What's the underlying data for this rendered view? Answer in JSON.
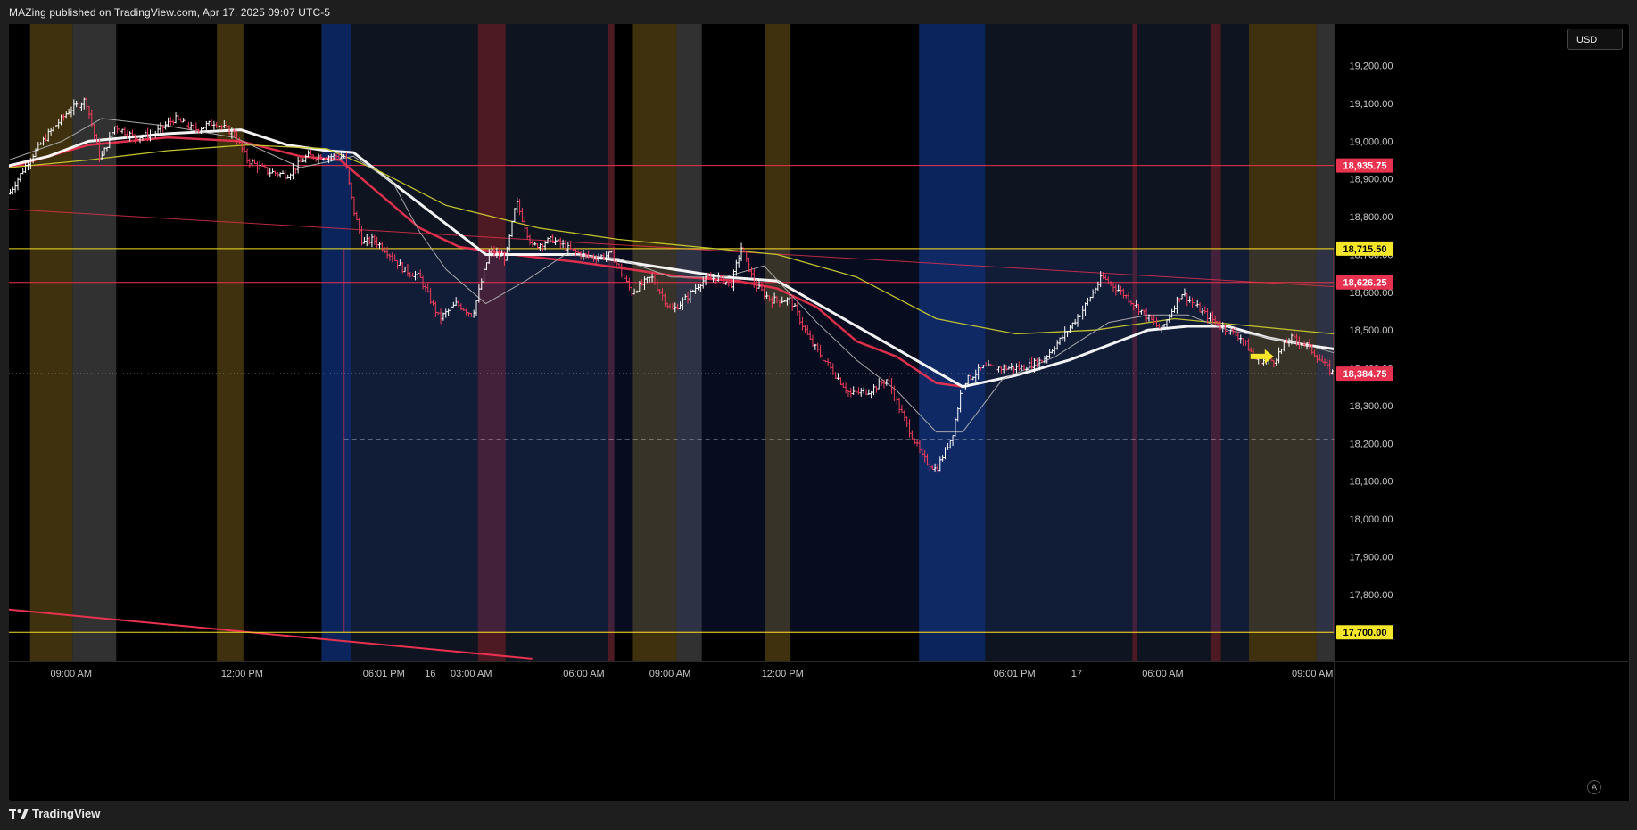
{
  "header": {
    "publish_text": "MAZing published on TradingView.com, Apr 17, 2025 09:07 UTC-5"
  },
  "brand": {
    "name": "TradingView"
  },
  "price_axis": {
    "currency": "USD",
    "autoscale_label": "A"
  },
  "colors": {
    "background": "#000000",
    "up": "#ffffff",
    "down": "#f23d5c",
    "ema_fast": "#ffffff",
    "ema_mid": "#e8324f",
    "ema_slow": "#c8c832",
    "sma_thin": "#b0b0b0",
    "level_red": "#e8324f",
    "level_yellow": "#f0e020",
    "label_red_bg": "#e8324f",
    "label_yellow_bg": "#f5e62a",
    "axis_text": "#c8c8c8",
    "session_asia": "#0d2a6b",
    "session_london": "#4a3a10",
    "session_ny_pre": "#3a3a3a",
    "session_night": "#101826",
    "session_kill": "#5a1f2a"
  },
  "chart_data": {
    "type": "candlestick",
    "symbol": "",
    "ylim": [
      17625,
      19310
    ],
    "y_ticks": [
      17700,
      17800,
      17900,
      18000,
      18100,
      18200,
      18300,
      18400,
      18500,
      18600,
      18700,
      18800,
      18900,
      19000,
      19100,
      19200
    ],
    "y_tick_labels": [
      "17,700.00",
      "17,800.00",
      "17,900.00",
      "18,000.00",
      "18,100.00",
      "18,200.00",
      "18,300.00",
      "18,400.00",
      "18,500.00",
      "18,600.00",
      "18,700.00",
      "18,800.00",
      "18,900.00",
      "19,000.00",
      "19,100.00",
      "19,200.00"
    ],
    "xlim": [
      0,
      100
    ],
    "x_ticks": [
      {
        "x": 4.7,
        "label": "09:00 AM"
      },
      {
        "x": 17.6,
        "label": "12:00 PM"
      },
      {
        "x": 28.3,
        "label": "06:01 PM"
      },
      {
        "x": 31.8,
        "label": "16"
      },
      {
        "x": 34.9,
        "label": "03:00 AM"
      },
      {
        "x": 43.4,
        "label": "06:00 AM"
      },
      {
        "x": 49.9,
        "label": "09:00 AM"
      },
      {
        "x": 58.4,
        "label": "12:00 PM"
      },
      {
        "x": 75.9,
        "label": "06:01 PM"
      },
      {
        "x": 80.6,
        "label": "17"
      },
      {
        "x": 87.1,
        "label": "06:00 AM"
      },
      {
        "x": 98.4,
        "label": "09:00 AM"
      }
    ],
    "price_path": [
      [
        0,
        18860
      ],
      [
        1.5,
        18950
      ],
      [
        3,
        19020
      ],
      [
        4.5,
        19080
      ],
      [
        5.8,
        19110
      ],
      [
        6.9,
        18950
      ],
      [
        8,
        19040
      ],
      [
        9.5,
        19010
      ],
      [
        11,
        19020
      ],
      [
        12.5,
        19060
      ],
      [
        14,
        19030
      ],
      [
        15.5,
        19050
      ],
      [
        17,
        19020
      ],
      [
        18,
        18950
      ],
      [
        19.5,
        18920
      ],
      [
        21,
        18910
      ],
      [
        22.5,
        18960
      ],
      [
        24,
        18960
      ],
      [
        25.3,
        18960
      ],
      [
        26,
        18820
      ],
      [
        26.7,
        18730
      ],
      [
        27.5,
        18740
      ],
      [
        28.5,
        18710
      ],
      [
        29.8,
        18660
      ],
      [
        31,
        18640
      ],
      [
        32.5,
        18530
      ],
      [
        33.8,
        18570
      ],
      [
        35,
        18540
      ],
      [
        36.3,
        18710
      ],
      [
        37.5,
        18690
      ],
      [
        38.3,
        18840
      ],
      [
        39.5,
        18720
      ],
      [
        41,
        18740
      ],
      [
        42.5,
        18710
      ],
      [
        44,
        18690
      ],
      [
        45.5,
        18700
      ],
      [
        47,
        18600
      ],
      [
        48.5,
        18640
      ],
      [
        50,
        18550
      ],
      [
        51,
        18580
      ],
      [
        52.3,
        18630
      ],
      [
        53.5,
        18640
      ],
      [
        54.5,
        18620
      ],
      [
        55.3,
        18720
      ],
      [
        56.3,
        18620
      ],
      [
        57.5,
        18580
      ],
      [
        59,
        18580
      ],
      [
        60.5,
        18470
      ],
      [
        62,
        18400
      ],
      [
        63.5,
        18330
      ],
      [
        65,
        18340
      ],
      [
        66.3,
        18370
      ],
      [
        67.5,
        18270
      ],
      [
        69,
        18160
      ],
      [
        70,
        18130
      ],
      [
        71.2,
        18220
      ],
      [
        72,
        18360
      ],
      [
        73.5,
        18400
      ],
      [
        75,
        18400
      ],
      [
        76.5,
        18400
      ],
      [
        78,
        18420
      ],
      [
        79.5,
        18480
      ],
      [
        81,
        18550
      ],
      [
        82.5,
        18640
      ],
      [
        84,
        18600
      ],
      [
        85.5,
        18550
      ],
      [
        87,
        18500
      ],
      [
        88.5,
        18600
      ],
      [
        90,
        18550
      ],
      [
        91.5,
        18510
      ],
      [
        93,
        18480
      ],
      [
        94.2,
        18420
      ],
      [
        95.5,
        18420
      ],
      [
        96.7,
        18480
      ],
      [
        98,
        18460
      ],
      [
        99.5,
        18400
      ],
      [
        100,
        18384
      ]
    ],
    "series": [
      {
        "name": "",
        "color_key": "ema_mid",
        "width": 2.5,
        "points": [
          [
            0,
            18930
          ],
          [
            6,
            18990
          ],
          [
            12,
            19010
          ],
          [
            17.5,
            19000
          ],
          [
            22,
            18960
          ],
          [
            25,
            18950
          ],
          [
            28,
            18860
          ],
          [
            31,
            18770
          ],
          [
            34,
            18720
          ],
          [
            38,
            18700
          ],
          [
            43,
            18680
          ],
          [
            47,
            18660
          ],
          [
            51,
            18640
          ],
          [
            55,
            18630
          ],
          [
            58,
            18610
          ],
          [
            61,
            18560
          ],
          [
            64,
            18470
          ],
          [
            67,
            18430
          ],
          [
            70,
            18360
          ],
          [
            72,
            18350
          ]
        ]
      },
      {
        "name": "",
        "color_key": "ema_fast",
        "width": 3,
        "points": [
          [
            0,
            18935
          ],
          [
            3,
            18960
          ],
          [
            6,
            19000
          ],
          [
            12,
            19020
          ],
          [
            17.5,
            19030
          ],
          [
            21,
            18990
          ],
          [
            24,
            18975
          ],
          [
            26,
            18970
          ],
          [
            36,
            18700
          ],
          [
            40,
            18700
          ],
          [
            43,
            18700
          ],
          [
            54,
            18640
          ],
          [
            58,
            18630
          ],
          [
            72,
            18350
          ],
          [
            76,
            18380
          ],
          [
            80,
            18420
          ],
          [
            83,
            18460
          ],
          [
            86,
            18500
          ],
          [
            89,
            18510
          ],
          [
            92,
            18510
          ],
          [
            95,
            18480
          ],
          [
            98,
            18460
          ],
          [
            100,
            18450
          ]
        ]
      },
      {
        "name": "",
        "color_key": "ema_slow",
        "width": 1.3,
        "points": [
          [
            0,
            18930
          ],
          [
            6,
            18950
          ],
          [
            12,
            18975
          ],
          [
            18,
            18990
          ],
          [
            24,
            18980
          ],
          [
            28,
            18920
          ],
          [
            33,
            18830
          ],
          [
            40,
            18770
          ],
          [
            46,
            18740
          ],
          [
            52,
            18720
          ],
          [
            58,
            18700
          ],
          [
            64,
            18640
          ],
          [
            70,
            18530
          ],
          [
            76,
            18490
          ],
          [
            82,
            18500
          ],
          [
            88,
            18530
          ],
          [
            94,
            18510
          ],
          [
            100,
            18490
          ]
        ]
      },
      {
        "name": "",
        "color_key": "sma_thin",
        "width": 1,
        "points": [
          [
            0,
            18950
          ],
          [
            4,
            19000
          ],
          [
            7,
            19060
          ],
          [
            12,
            19040
          ],
          [
            17,
            19010
          ],
          [
            22,
            18930
          ],
          [
            26,
            18960
          ],
          [
            29,
            18890
          ],
          [
            31,
            18760
          ],
          [
            33,
            18660
          ],
          [
            36,
            18570
          ],
          [
            39,
            18630
          ],
          [
            42,
            18700
          ],
          [
            46,
            18690
          ],
          [
            50,
            18640
          ],
          [
            54,
            18640
          ],
          [
            57,
            18670
          ],
          [
            61,
            18520
          ],
          [
            64,
            18420
          ],
          [
            67,
            18340
          ],
          [
            70,
            18230
          ],
          [
            72,
            18230
          ],
          [
            75,
            18370
          ],
          [
            79,
            18430
          ],
          [
            83,
            18520
          ],
          [
            86,
            18540
          ],
          [
            89,
            18540
          ],
          [
            92,
            18500
          ],
          [
            95,
            18480
          ],
          [
            98,
            18460
          ],
          [
            100,
            18440
          ]
        ]
      }
    ],
    "levels": [
      {
        "price": 18935.75,
        "label": "18,935.75",
        "style": "red"
      },
      {
        "price": 18715.5,
        "label": "18,715.50",
        "style": "yellow"
      },
      {
        "price": 18626.25,
        "label": "18,626.25",
        "style": "red"
      },
      {
        "price": 18384.75,
        "label": "18,384.75",
        "style": "current"
      },
      {
        "price": 17700.0,
        "label": "17,700.00",
        "style": "yellow"
      }
    ],
    "dashed_level": {
      "price": 18210,
      "x_start": 25.3
    },
    "trendlines": [
      {
        "style": "red",
        "points": [
          [
            0,
            18820
          ],
          [
            100,
            18615
          ]
        ]
      },
      {
        "style": "red_thick",
        "points": [
          [
            0,
            17760
          ],
          [
            39.5,
            17630
          ]
        ]
      }
    ],
    "range_box": {
      "x_start": 25.3,
      "top": 18715.5,
      "bottom": 17700
    },
    "arrow_marker": {
      "x": 94.8,
      "price": 18430
    },
    "sessions": [
      {
        "x0": 1.6,
        "x1": 4.8,
        "kind": "session_london"
      },
      {
        "x0": 4.8,
        "x1": 8.1,
        "kind": "session_ny_pre"
      },
      {
        "x0": 15.7,
        "x1": 17.7,
        "kind": "session_london"
      },
      {
        "x0": 23.6,
        "x1": 25.8,
        "kind": "session_asia"
      },
      {
        "x0": 25.8,
        "x1": 35.4,
        "kind": "session_night"
      },
      {
        "x0": 35.4,
        "x1": 37.5,
        "kind": "session_kill"
      },
      {
        "x0": 37.5,
        "x1": 45.2,
        "kind": "session_night"
      },
      {
        "x0": 45.2,
        "x1": 45.7,
        "kind": "session_kill"
      },
      {
        "x0": 47.1,
        "x1": 50.4,
        "kind": "session_london"
      },
      {
        "x0": 50.4,
        "x1": 52.3,
        "kind": "session_ny_pre"
      },
      {
        "x0": 57.1,
        "x1": 59.0,
        "kind": "session_london"
      },
      {
        "x0": 68.7,
        "x1": 73.7,
        "kind": "session_asia"
      },
      {
        "x0": 73.7,
        "x1": 84.8,
        "kind": "session_night"
      },
      {
        "x0": 84.8,
        "x1": 85.2,
        "kind": "session_kill"
      },
      {
        "x0": 85.2,
        "x1": 90.7,
        "kind": "session_night"
      },
      {
        "x0": 90.7,
        "x1": 91.5,
        "kind": "session_kill"
      },
      {
        "x0": 91.5,
        "x1": 93.6,
        "kind": "session_night"
      },
      {
        "x0": 93.6,
        "x1": 98.7,
        "kind": "session_london"
      },
      {
        "x0": 98.7,
        "x1": 100,
        "kind": "session_ny_pre"
      }
    ]
  }
}
